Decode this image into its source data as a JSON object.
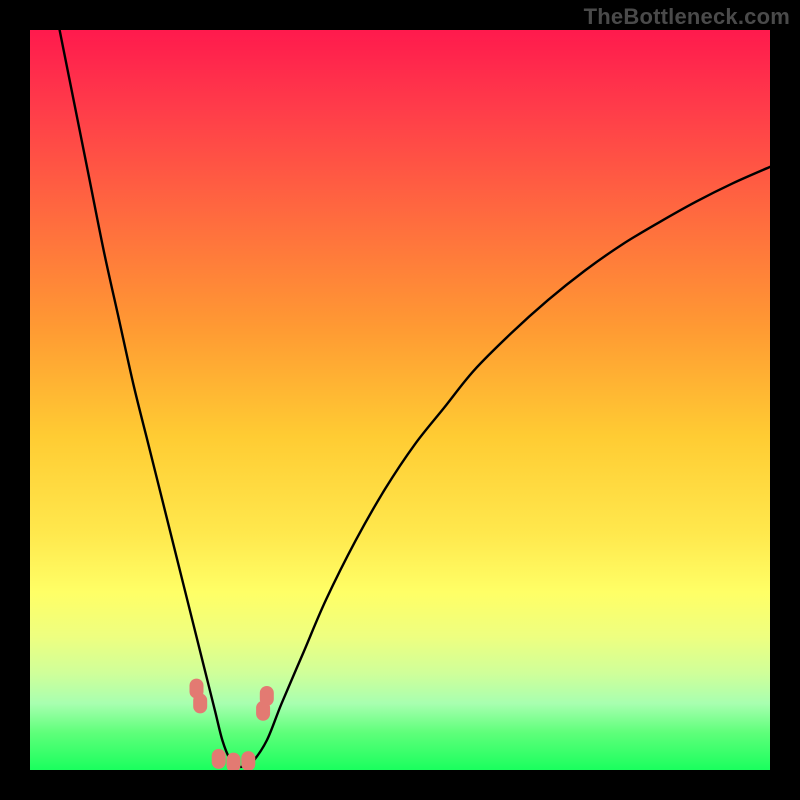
{
  "watermark": "TheBottleneck.com",
  "chart_data": {
    "type": "line",
    "title": "",
    "xlabel": "",
    "ylabel": "",
    "xlim": [
      0,
      100
    ],
    "ylim": [
      0,
      100
    ],
    "grid": false,
    "series": [
      {
        "name": "curve",
        "x": [
          4,
          6,
          8,
          10,
          12,
          14,
          16,
          18,
          20,
          22,
          23.5,
          25,
          26,
          27,
          28,
          29,
          30,
          32,
          34,
          37,
          40,
          44,
          48,
          52,
          56,
          60,
          65,
          70,
          75,
          80,
          85,
          90,
          95,
          100
        ],
        "y": [
          100,
          90,
          80,
          70,
          61,
          52,
          44,
          36,
          28,
          20,
          14,
          8,
          4,
          1.5,
          0.5,
          0.5,
          1,
          4,
          9,
          16,
          23,
          31,
          38,
          44,
          49,
          54,
          59,
          63.5,
          67.5,
          71,
          74,
          76.8,
          79.3,
          81.5
        ]
      }
    ],
    "markers": [
      {
        "x": 22.5,
        "y": 11
      },
      {
        "x": 23.0,
        "y": 9
      },
      {
        "x": 25.5,
        "y": 1.5
      },
      {
        "x": 27.5,
        "y": 1.0
      },
      {
        "x": 29.5,
        "y": 1.2
      },
      {
        "x": 31.5,
        "y": 8
      },
      {
        "x": 32.0,
        "y": 10
      }
    ],
    "background_gradient": {
      "top": "#ff1a4d",
      "bottom": "#1aff5e"
    }
  }
}
